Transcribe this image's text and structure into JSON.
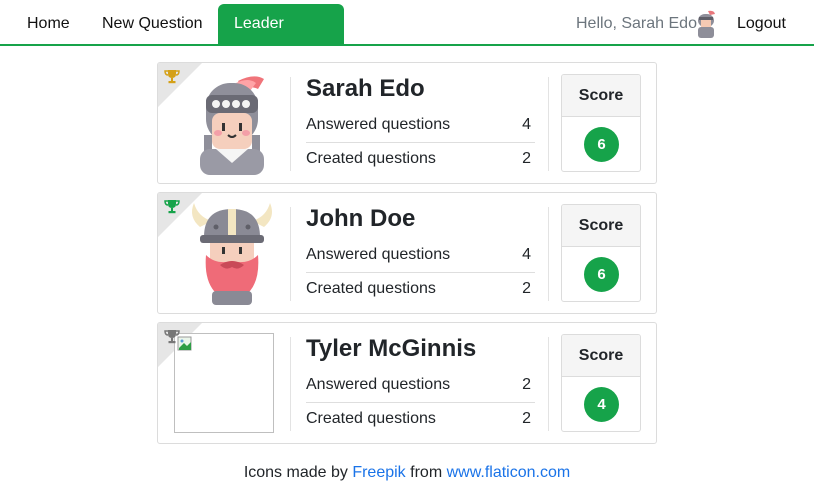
{
  "nav": {
    "home": "Home",
    "new_question": "New Question",
    "leader_board": "Leader Board",
    "greeting": "Hello, Sarah Edo",
    "logout": "Logout",
    "accent": "#16a34a"
  },
  "leaderboard": {
    "answered_label": "Answered questions",
    "created_label": "Created questions",
    "score_label": "Score",
    "entries": [
      {
        "name": "Sarah Edo",
        "answered": "4",
        "created": "2",
        "score": "6",
        "trophy_color": "#d4a017",
        "avatar": "knight-avatar"
      },
      {
        "name": "John Doe",
        "answered": "4",
        "created": "2",
        "score": "6",
        "trophy_color": "#16a34a",
        "avatar": "viking-avatar"
      },
      {
        "name": "Tyler McGinnis",
        "answered": "2",
        "created": "2",
        "score": "4",
        "trophy_color": "#777777",
        "avatar": "broken-image"
      }
    ]
  },
  "footer": {
    "prefix": "Icons made by",
    "author": "Freepik",
    "middle": "from",
    "site": "www.flaticon.com"
  }
}
